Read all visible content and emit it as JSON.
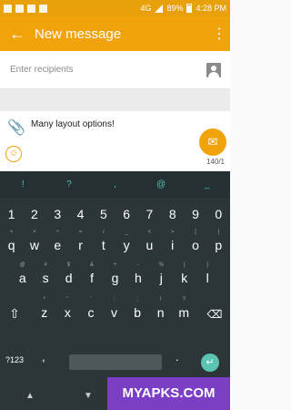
{
  "status": {
    "network": "4G",
    "battery": "89%",
    "time": "4:28 PM"
  },
  "appbar": {
    "title": "New message",
    "back_icon": "←",
    "more_icon": "⋮"
  },
  "recipients": {
    "placeholder": "Enter recipients"
  },
  "compose": {
    "message": "Many layout options!",
    "counter": "140/1",
    "emoji_icon": "☺",
    "send_icon": "✉"
  },
  "keyboard": {
    "suggestions": [
      "!",
      "?",
      ",",
      "@",
      "_"
    ],
    "number_row": [
      "1",
      "2",
      "3",
      "4",
      "5",
      "6",
      "7",
      "8",
      "9",
      "0"
    ],
    "row1": [
      {
        "main": "q",
        "sub": "+"
      },
      {
        "main": "w",
        "sub": "×"
      },
      {
        "main": "e",
        "sub": "÷"
      },
      {
        "main": "r",
        "sub": "="
      },
      {
        "main": "t",
        "sub": "/"
      },
      {
        "main": "y",
        "sub": "_"
      },
      {
        "main": "u",
        "sub": "<"
      },
      {
        "main": "i",
        "sub": ">"
      },
      {
        "main": "o",
        "sub": "["
      },
      {
        "main": "p",
        "sub": "]"
      }
    ],
    "row2": [
      {
        "main": "a",
        "sub": "@"
      },
      {
        "main": "s",
        "sub": "#"
      },
      {
        "main": "d",
        "sub": "$"
      },
      {
        "main": "f",
        "sub": "&"
      },
      {
        "main": "g",
        "sub": "+"
      },
      {
        "main": "h",
        "sub": "-"
      },
      {
        "main": "j",
        "sub": "%"
      },
      {
        "main": "k",
        "sub": "("
      },
      {
        "main": "l",
        "sub": ")"
      }
    ],
    "row3": [
      {
        "main": "z",
        "sub": "*"
      },
      {
        "main": "x",
        "sub": "\""
      },
      {
        "main": "c",
        "sub": "'"
      },
      {
        "main": "v",
        "sub": ":"
      },
      {
        "main": "b",
        "sub": ";"
      },
      {
        "main": "n",
        "sub": "!"
      },
      {
        "main": "m",
        "sub": "?"
      }
    ],
    "shift_icon": "⇧",
    "delete_icon": "⌫",
    "symbols_label": "?123",
    "comma": ",",
    "period": ".",
    "enter_icon": "↵"
  },
  "nav": {
    "back_icon": "▲",
    "home_icon": "▼"
  },
  "watermark": "MYAPKS.COM"
}
